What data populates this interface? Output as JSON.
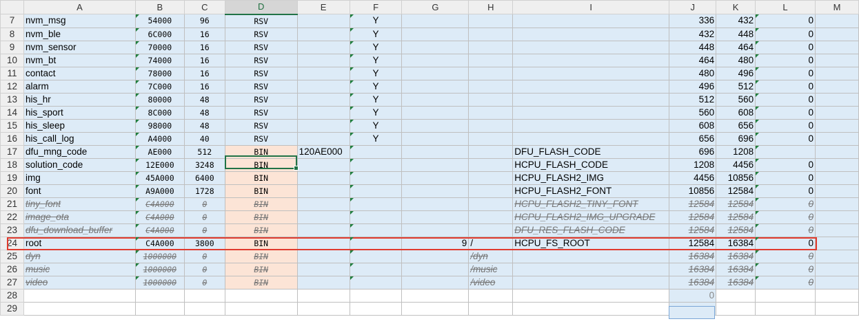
{
  "columns": [
    "",
    "A",
    "B",
    "C",
    "D",
    "E",
    "F",
    "G",
    "H",
    "I",
    "J",
    "K",
    "L",
    "M"
  ],
  "selected_column": "D",
  "rows": [
    {
      "n": "7",
      "a": "nvm_msg",
      "b": "54000",
      "c": "96",
      "d": "RSV",
      "e": "",
      "f": "Y",
      "g": "",
      "h": "",
      "i": "",
      "j": "336",
      "k": "432",
      "l": "0",
      "type": "rsv"
    },
    {
      "n": "8",
      "a": "nvm_ble",
      "b": "6C000",
      "c": "16",
      "d": "RSV",
      "e": "",
      "f": "Y",
      "g": "",
      "h": "",
      "i": "",
      "j": "432",
      "k": "448",
      "l": "0",
      "type": "rsv"
    },
    {
      "n": "9",
      "a": "nvm_sensor",
      "b": "70000",
      "c": "16",
      "d": "RSV",
      "e": "",
      "f": "Y",
      "g": "",
      "h": "",
      "i": "",
      "j": "448",
      "k": "464",
      "l": "0",
      "type": "rsv"
    },
    {
      "n": "10",
      "a": "nvm_bt",
      "b": "74000",
      "c": "16",
      "d": "RSV",
      "e": "",
      "f": "Y",
      "g": "",
      "h": "",
      "i": "",
      "j": "464",
      "k": "480",
      "l": "0",
      "type": "rsv"
    },
    {
      "n": "11",
      "a": "contact",
      "b": "78000",
      "c": "16",
      "d": "RSV",
      "e": "",
      "f": "Y",
      "g": "",
      "h": "",
      "i": "",
      "j": "480",
      "k": "496",
      "l": "0",
      "type": "rsv"
    },
    {
      "n": "12",
      "a": "alarm",
      "b": "7C000",
      "c": "16",
      "d": "RSV",
      "e": "",
      "f": "Y",
      "g": "",
      "h": "",
      "i": "",
      "j": "496",
      "k": "512",
      "l": "0",
      "type": "rsv"
    },
    {
      "n": "13",
      "a": "his_hr",
      "b": "80000",
      "c": "48",
      "d": "RSV",
      "e": "",
      "f": "Y",
      "g": "",
      "h": "",
      "i": "",
      "j": "512",
      "k": "560",
      "l": "0",
      "type": "rsv"
    },
    {
      "n": "14",
      "a": "his_sport",
      "b": "8C000",
      "c": "48",
      "d": "RSV",
      "e": "",
      "f": "Y",
      "g": "",
      "h": "",
      "i": "",
      "j": "560",
      "k": "608",
      "l": "0",
      "type": "rsv"
    },
    {
      "n": "15",
      "a": "his_sleep",
      "b": "98000",
      "c": "48",
      "d": "RSV",
      "e": "",
      "f": "Y",
      "g": "",
      "h": "",
      "i": "",
      "j": "608",
      "k": "656",
      "l": "0",
      "type": "rsv"
    },
    {
      "n": "16",
      "a": "his_call_log",
      "b": "A4000",
      "c": "40",
      "d": "RSV",
      "e": "",
      "f": "Y",
      "g": "",
      "h": "",
      "i": "",
      "j": "656",
      "k": "696",
      "l": "0",
      "type": "rsv"
    },
    {
      "n": "17",
      "a": "dfu_mng_code",
      "b": "AE000",
      "c": "512",
      "d": "BIN",
      "e": "120AE000",
      "f": "",
      "g": "",
      "h": "",
      "i": "DFU_FLASH_CODE",
      "j": "696",
      "k": "1208",
      "l": "",
      "type": "bin"
    },
    {
      "n": "18",
      "a": "solution_code",
      "b": "12E000",
      "c": "3248",
      "d": "BIN",
      "e": "",
      "f": "",
      "g": "",
      "h": "",
      "i": "HCPU_FLASH_CODE",
      "j": "1208",
      "k": "4456",
      "l": "0",
      "type": "bin"
    },
    {
      "n": "19",
      "a": "img",
      "b": "45A000",
      "c": "6400",
      "d": "BIN",
      "e": "",
      "f": "",
      "g": "",
      "h": "",
      "i": "HCPU_FLASH2_IMG",
      "j": "4456",
      "k": "10856",
      "l": "0",
      "type": "bin"
    },
    {
      "n": "20",
      "a": "font",
      "b": "A9A000",
      "c": "1728",
      "d": "BIN",
      "e": "",
      "f": "",
      "g": "",
      "h": "",
      "i": "HCPU_FLASH2_FONT",
      "j": "10856",
      "k": "12584",
      "l": "0",
      "type": "bin"
    },
    {
      "n": "21",
      "a": "tiny_font",
      "b": "C4A000",
      "c": "0",
      "d": "BIN",
      "e": "",
      "f": "",
      "g": "",
      "h": "",
      "i": "HCPU_FLASH2_TINY_FONT",
      "j": "12584",
      "k": "12584",
      "l": "0",
      "type": "strike"
    },
    {
      "n": "22",
      "a": "image_ota",
      "b": "C4A000",
      "c": "0",
      "d": "BIN",
      "e": "",
      "f": "",
      "g": "",
      "h": "",
      "i": "HCPU_FLASH2_IMG_UPGRADE",
      "j": "12584",
      "k": "12584",
      "l": "0",
      "type": "strike"
    },
    {
      "n": "23",
      "a": "dfu_download_buffer",
      "b": "C4A000",
      "c": "0",
      "d": "BIN",
      "e": "",
      "f": "",
      "g": "",
      "h": "",
      "i": "DFU_RES_FLASH_CODE",
      "j": "12584",
      "k": "12584",
      "l": "0",
      "type": "strike"
    },
    {
      "n": "24",
      "a": "root",
      "b": "C4A000",
      "c": "3800",
      "d": "BIN",
      "e": "",
      "f": "",
      "g": "9",
      "h": "/",
      "i": "HCPU_FS_ROOT",
      "j": "12584",
      "k": "16384",
      "l": "0",
      "type": "bin"
    },
    {
      "n": "25",
      "a": "dyn",
      "b": "1000000",
      "c": "0",
      "d": "BIN",
      "e": "",
      "f": "",
      "g": "",
      "h": "/dyn",
      "i": "",
      "j": "16384",
      "k": "16384",
      "l": "0",
      "type": "strike"
    },
    {
      "n": "26",
      "a": "music",
      "b": "1000000",
      "c": "0",
      "d": "BIN",
      "e": "",
      "f": "",
      "g": "",
      "h": "/music",
      "i": "",
      "j": "16384",
      "k": "16384",
      "l": "0",
      "type": "strike"
    },
    {
      "n": "27",
      "a": "video",
      "b": "1000000",
      "c": "0",
      "d": "BIN",
      "e": "",
      "f": "",
      "g": "",
      "h": "/video",
      "i": "",
      "j": "16384",
      "k": "16384",
      "l": "0",
      "type": "strike"
    },
    {
      "n": "28",
      "a": "",
      "b": "",
      "c": "",
      "d": "",
      "e": "",
      "f": "",
      "g": "",
      "h": "",
      "i": "",
      "j": "0",
      "k": "",
      "l": "",
      "type": "blank"
    },
    {
      "n": "29",
      "a": "",
      "b": "",
      "c": "",
      "d": "",
      "e": "",
      "f": "",
      "g": "",
      "h": "",
      "i": "",
      "j": "",
      "k": "",
      "l": "",
      "type": "blank"
    }
  ],
  "colors": {
    "row_fill": "#ddebf7",
    "bin_fill": "#fce4d6",
    "highlight_border": "#e03a2e",
    "selection": "#217346"
  }
}
